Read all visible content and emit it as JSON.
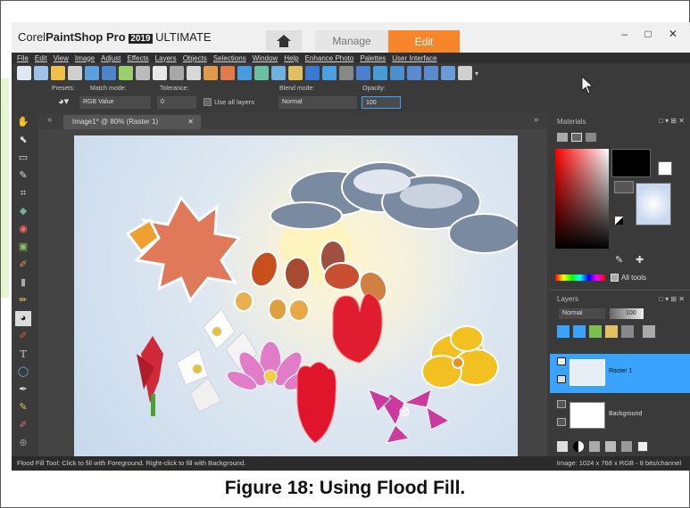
{
  "app": {
    "brand_prefix": "Corel",
    "brand_name": "PaintShop Pro",
    "year_badge": "2019",
    "edition": "ULTIMATE"
  },
  "workspace_tabs": {
    "manage": "Manage",
    "edit": "Edit"
  },
  "window_controls": "– □ ✕",
  "menu": [
    "File",
    "Edit",
    "View",
    "Image",
    "Adjust",
    "Effects",
    "Layers",
    "Objects",
    "Selections",
    "Window",
    "Help",
    "Enhance Photo",
    "Palettes",
    "User Interface"
  ],
  "tool_options": {
    "presets_label": "Presets:",
    "match_mode_label": "Match mode:",
    "match_mode_value": "RGB Value",
    "tolerance_label": "Tolerance:",
    "tolerance_value": "0",
    "use_all_layers_label": "Use all layers",
    "blend_mode_label": "Blend mode:",
    "blend_mode_value": "Normal",
    "opacity_label": "Opacity:",
    "opacity_value": "100"
  },
  "document_tab": {
    "title": "Image1* @  80% (Raster 1)",
    "close": "✕"
  },
  "materials": {
    "title": "Materials",
    "all_tools_label": "All tools",
    "foreground_color": "#000000",
    "background_color": "#ffffff"
  },
  "layers": {
    "title": "Layers",
    "blend_mode": "Normal",
    "opacity": "100",
    "items": [
      {
        "name": "Raster 1",
        "selected": true
      },
      {
        "name": "Background",
        "selected": false
      }
    ]
  },
  "status": {
    "left": "Flood Fill Tool: Click to fill with Foreground. Right-click to fill with Background.",
    "right": "Image:  1024 x 768 x RGB - 8 bits/channel"
  },
  "caption": "Figure 18: Using Flood Fill.",
  "colors": {
    "accent_orange": "#f7862a",
    "selection_blue": "#3aa3ff",
    "dark_bg": "#3a3a3a"
  }
}
